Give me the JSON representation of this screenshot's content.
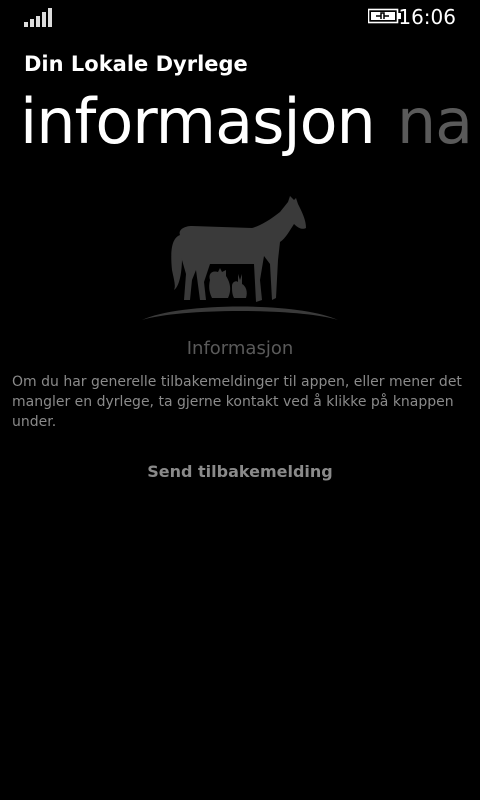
{
  "status_bar": {
    "time": "16:06",
    "signal_icon": "signal-strength-icon",
    "battery_icon": "battery-charging-icon"
  },
  "app": {
    "title": "Din Lokale Dyrlege"
  },
  "pivot": {
    "items": [
      {
        "label": "informasjon",
        "active": true
      },
      {
        "label": "na",
        "active": false
      }
    ]
  },
  "content": {
    "logo_icon": "horse-cat-rabbit-logo-icon",
    "section_title": "Informasjon",
    "body": "Om du har generelle tilbakemeldinger til appen, eller mener det mangler en dyrlege, ta gjerne kontakt ved å klikke på knappen under.",
    "send_label": "Send tilbakemelding"
  },
  "colors": {
    "background": "#000000",
    "text_primary": "#ffffff",
    "text_secondary": "#8a8a8a",
    "text_inactive": "#5a5a5a",
    "logo": "#3a3a3a"
  }
}
